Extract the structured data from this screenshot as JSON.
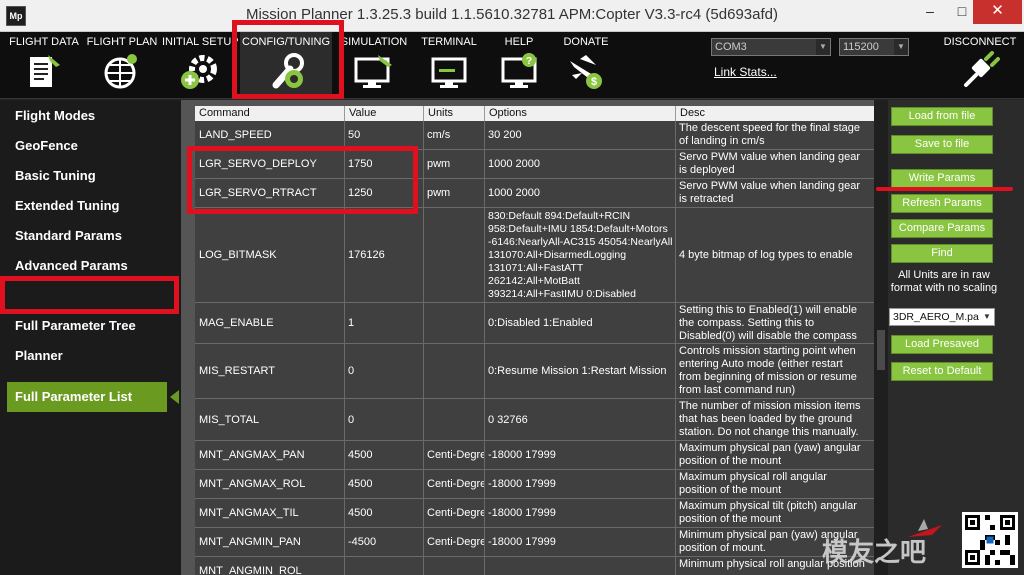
{
  "window": {
    "title": "Mission Planner 1.3.25.3 build 1.1.5610.32781 APM:Copter V3.3-rc4 (5d693afd)",
    "app_icon": "Mp",
    "minimize": "–",
    "maximize": "□",
    "close": "✕"
  },
  "toolbar": {
    "items": [
      {
        "label": "FLIGHT DATA",
        "icon": "flight-data-icon"
      },
      {
        "label": "FLIGHT PLAN",
        "icon": "flight-plan-icon"
      },
      {
        "label": "INITIAL SETUP",
        "icon": "initial-setup-icon"
      },
      {
        "label": "CONFIG/TUNING",
        "icon": "config-tuning-icon",
        "active": true
      },
      {
        "label": "SIMULATION",
        "icon": "simulation-icon"
      },
      {
        "label": "TERMINAL",
        "icon": "terminal-icon"
      },
      {
        "label": "HELP",
        "icon": "help-icon"
      },
      {
        "label": "DONATE",
        "icon": "donate-icon"
      }
    ],
    "port": "COM3",
    "baud": "115200",
    "link_stats": "Link Stats...",
    "disconnect": "DISCONNECT"
  },
  "sidebar": {
    "items": [
      {
        "label": "Flight Modes"
      },
      {
        "label": "GeoFence"
      },
      {
        "label": "Basic Tuning"
      },
      {
        "label": "Extended Tuning"
      },
      {
        "label": "Standard Params"
      },
      {
        "label": "Advanced Params"
      },
      {
        "label": "Full Parameter List",
        "active": true
      },
      {
        "label": "Full Parameter Tree"
      },
      {
        "label": "Planner"
      }
    ]
  },
  "grid": {
    "headers": {
      "command": "Command",
      "value": "Value",
      "units": "Units",
      "options": "Options",
      "desc": "Desc"
    },
    "rows": [
      {
        "command": "LAND_SPEED",
        "value": "50",
        "units": "cm/s",
        "options": "30 200",
        "desc": "The descent speed for the final stage of landing in cm/s"
      },
      {
        "command": "LGR_SERVO_DEPLOY",
        "value": "1750",
        "units": "pwm",
        "options": "1000 2000",
        "desc": "Servo PWM value when landing gear is deployed"
      },
      {
        "command": "LGR_SERVO_RTRACT",
        "value": "1250",
        "units": "pwm",
        "options": "1000 2000",
        "desc": "Servo PWM value when landing gear is retracted"
      },
      {
        "command": "LOG_BITMASK",
        "value": "176126",
        "units": "",
        "options": "830:Default 894:Default+RCIN 958:Default+IMU 1854:Default+Motors -6146:NearlyAll-AC315 45054:NearlyAll 131070:All+DisarmedLogging 131071:All+FastATT 262142:All+MotBatt 393214:All+FastIMU 0:Disabled",
        "desc": "4 byte bitmap of log types to enable"
      },
      {
        "command": "MAG_ENABLE",
        "value": "1",
        "units": "",
        "options": "0:Disabled 1:Enabled",
        "desc": "Setting this to Enabled(1) will enable the compass. Setting this to Disabled(0) will disable the compass"
      },
      {
        "command": "MIS_RESTART",
        "value": "0",
        "units": "",
        "options": "0:Resume Mission  1:Restart Mission",
        "desc": "Controls mission starting point when entering Auto mode (either restart from beginning of mission or resume from last command run)"
      },
      {
        "command": "MIS_TOTAL",
        "value": "0",
        "units": "",
        "options": "0 32766",
        "desc": "The number of mission mission items that has been loaded by the ground station. Do not change this manually."
      },
      {
        "command": "MNT_ANGMAX_PAN",
        "value": "4500",
        "units": "Centi-Degrees",
        "options": "-18000 17999",
        "desc": "Maximum physical pan (yaw) angular position of the mount"
      },
      {
        "command": "MNT_ANGMAX_ROL",
        "value": "4500",
        "units": "Centi-Degrees",
        "options": "-18000 17999",
        "desc": "Maximum physical roll angular position of the mount"
      },
      {
        "command": "MNT_ANGMAX_TIL",
        "value": "4500",
        "units": "Centi-Degrees",
        "options": "-18000 17999",
        "desc": "Maximum physical tilt (pitch) angular position of the mount"
      },
      {
        "command": "MNT_ANGMIN_PAN",
        "value": "-4500",
        "units": "Centi-Degrees",
        "options": "-18000 17999",
        "desc": "Minimum physical pan (yaw) angular position of mount."
      },
      {
        "command": "MNT_ANGMIN_ROL",
        "value": "",
        "units": "",
        "options": "",
        "desc": "Minimum physical roll angular position"
      }
    ]
  },
  "panel": {
    "load_from_file": "Load from file",
    "save_to_file": "Save to file",
    "write_params": "Write Params",
    "refresh_params": "Refresh Params",
    "compare_params": "Compare Params",
    "find": "Find",
    "note": "All Units are in raw format with no scaling",
    "preset": "3DR_AERO_M.pa",
    "load_presaved": "Load Presaved",
    "reset_default": "Reset to Default"
  },
  "watermark": {
    "text": "模友之吧"
  },
  "colors": {
    "accent_green": "#8ac542",
    "active_green": "#6a9a1f",
    "annotation_red": "#e0101e"
  }
}
